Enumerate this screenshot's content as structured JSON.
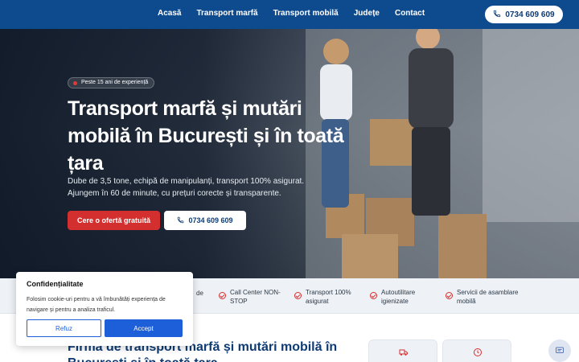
{
  "nav": {
    "items": [
      "Acasă",
      "Transport marfă",
      "Transport mobilă",
      "Județe",
      "Contact"
    ],
    "phone": "0734 609 609"
  },
  "hero": {
    "badge": "Peste 15 ani de experiență",
    "title": "Transport marfă și mutări mobilă în București și în toată țara",
    "description": "Dube de 3,5 tone, echipă de manipulanți, transport 100% asigurat. Ajungem în 60 de minute, cu prețuri corecte și transparente.",
    "cta_primary": "Cere o ofertă gratuită",
    "cta_phone": "0734 609 609"
  },
  "features": [
    "de",
    "Call Center NON-STOP",
    "Transport 100% asigurat",
    "Autoutilitare igienizate",
    "Servicii de asamblare mobilă"
  ],
  "section": {
    "title": "Firma de transport marfă și mutări mobilă în București și în toată țara"
  },
  "cookie": {
    "title": "Confidențialitate",
    "text": "Folosim cookie-uri pentru a vă îmbunătăți experiența de navigare și pentru a analiza traficul.",
    "refuse": "Refuz",
    "accept": "Accept"
  },
  "colors": {
    "nav_bg": "#0e4a8e",
    "accent_red": "#d32f2f",
    "brand_blue": "#0e3b73",
    "cookie_blue": "#1d5fd8"
  },
  "icons": [
    "phone-icon",
    "check-circle-icon",
    "truck-icon",
    "clock-icon",
    "chat-icon"
  ]
}
